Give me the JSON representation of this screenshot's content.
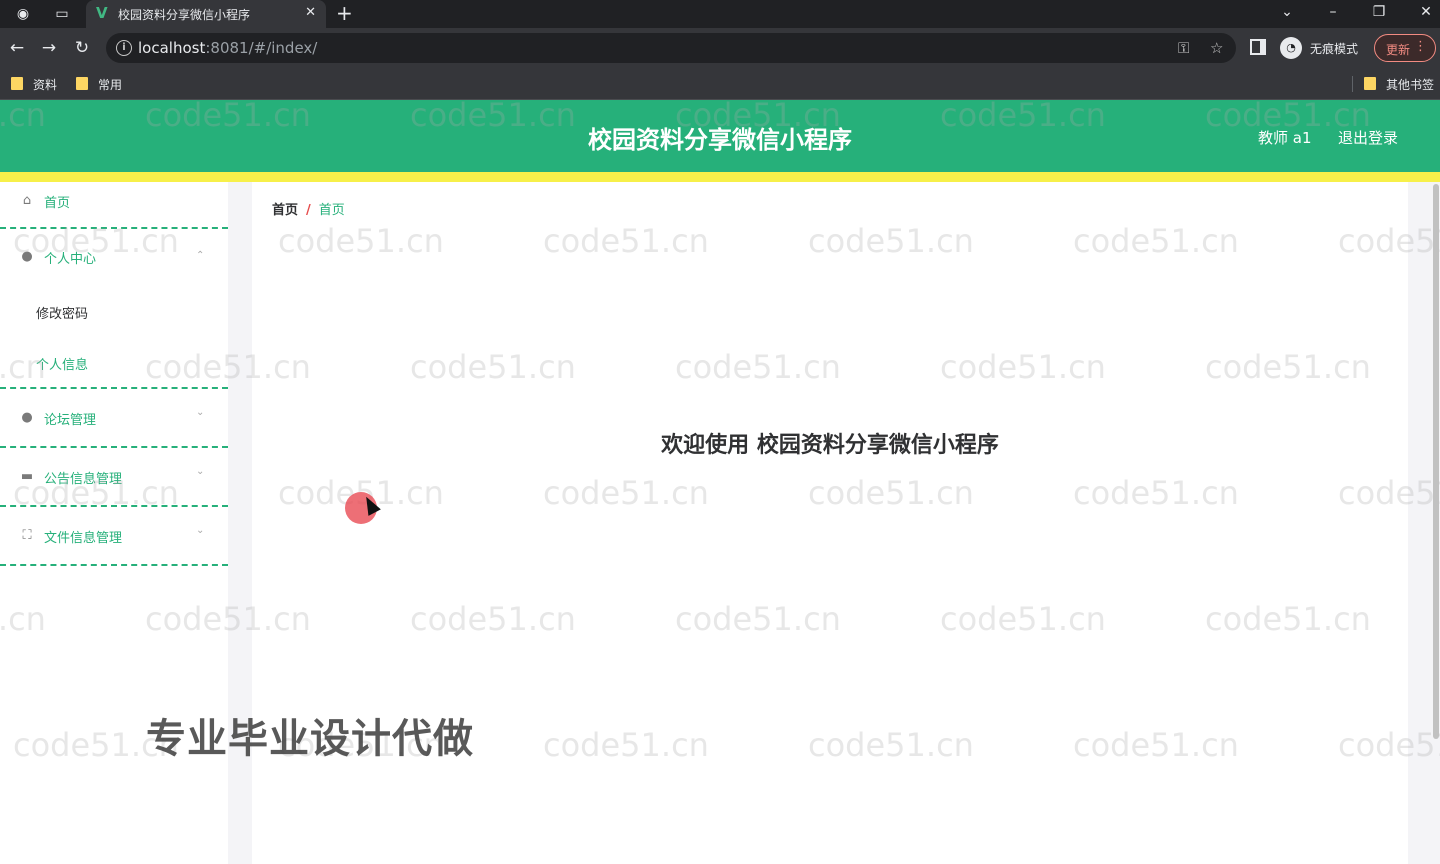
{
  "browser": {
    "tab_title": "校园资料分享微信小程序",
    "tab_favicon": "V",
    "url_host": "localhost",
    "url_rest": ":8081/#/index/",
    "profile_label": "无痕模式",
    "update_label": "更新",
    "bookmarks": [
      "资料",
      "常用"
    ],
    "other_bookmarks": "其他书签"
  },
  "header": {
    "title": "校园资料分享微信小程序",
    "user": "教师 a1",
    "logout": "退出登录",
    "color": "#26b07a",
    "accent": "#f7f04a"
  },
  "sidebar": {
    "home": "首页",
    "personal_center": "个人中心",
    "change_password": "修改密码",
    "personal_info": "个人信息",
    "forum": "论坛管理",
    "notice": "公告信息管理",
    "files": "文件信息管理"
  },
  "breadcrumb": {
    "home": "首页",
    "separator": "/",
    "current": "首页"
  },
  "main": {
    "welcome": "欢迎使用 校园资料分享微信小程序"
  },
  "overlay": {
    "watermark": "code51.cn",
    "promo": "专业毕业设计代做"
  }
}
